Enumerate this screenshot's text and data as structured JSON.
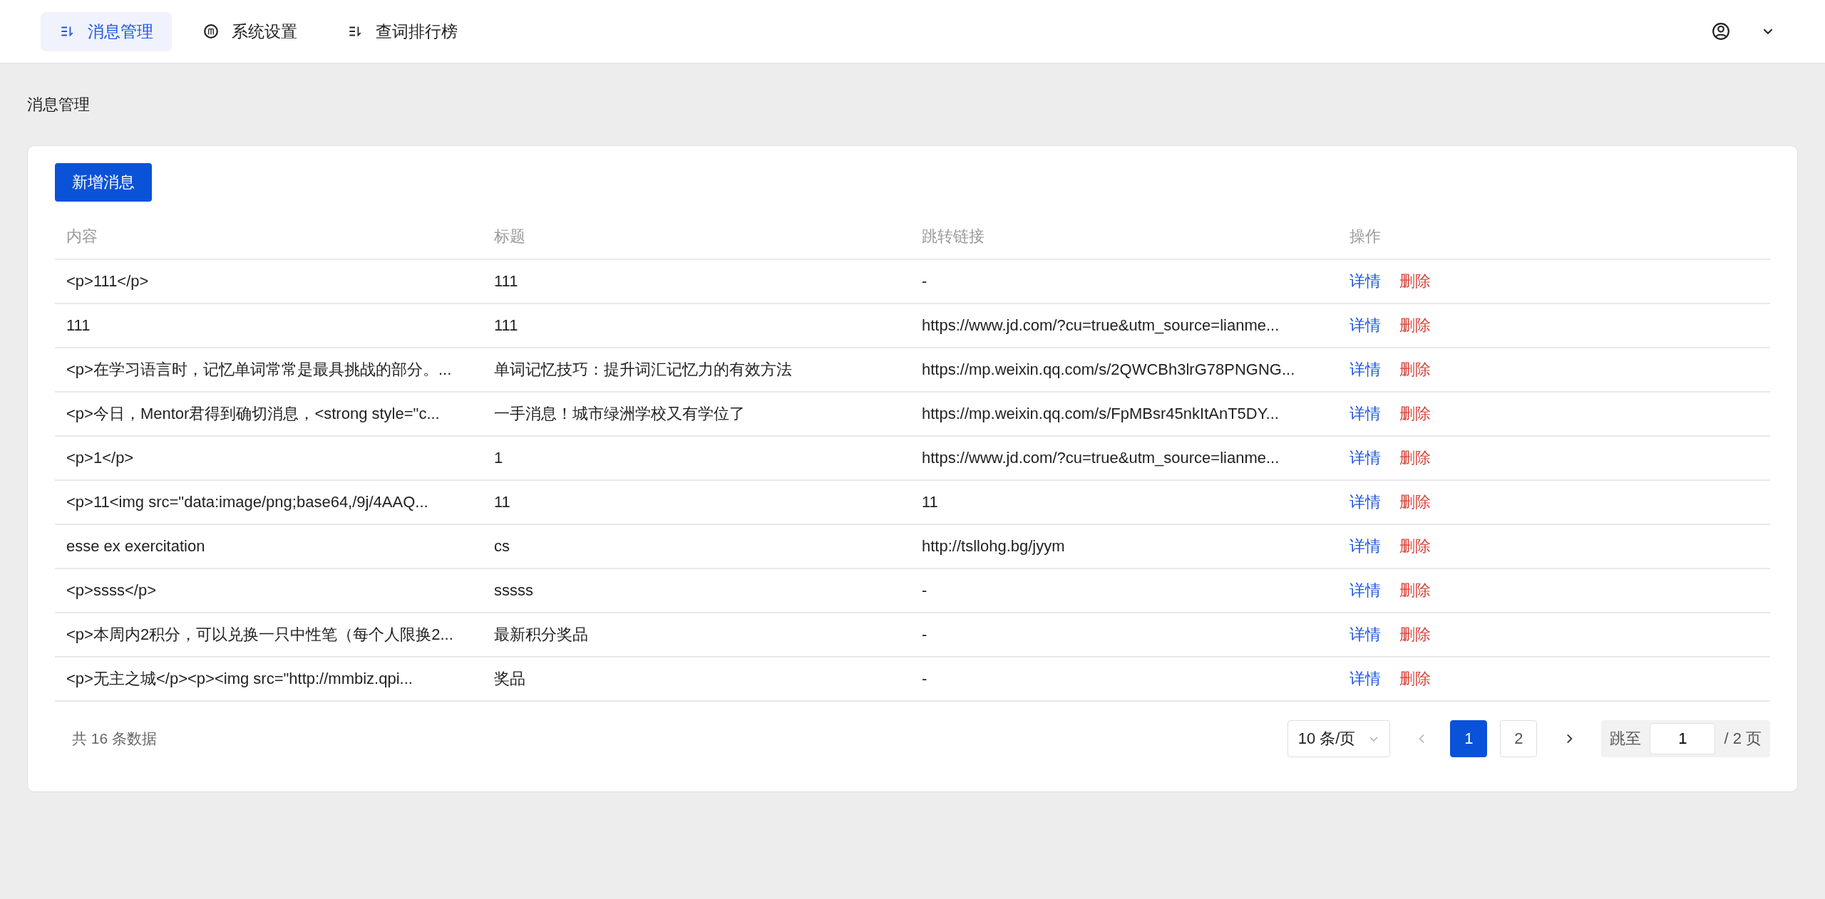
{
  "nav": {
    "items": [
      {
        "label": "消息管理",
        "kind": "list",
        "selected": true
      },
      {
        "label": "系统设置",
        "kind": "settings",
        "selected": false
      },
      {
        "label": "查词排行榜",
        "kind": "list",
        "selected": false
      }
    ]
  },
  "breadcrumb": "消息管理",
  "add_button": "新增消息",
  "table": {
    "columns": [
      "内容",
      "标题",
      "跳转链接",
      "操作"
    ],
    "rows": [
      {
        "content": "<p>111</p>",
        "title": "111",
        "link": "-",
        "actions": [
          "详情",
          "删除"
        ]
      },
      {
        "content": "111",
        "title": "111",
        "link": "https://www.jd.com/?cu=true&utm_source=lianme...",
        "actions": [
          "详情",
          "删除"
        ]
      },
      {
        "content": "<p>在学习语言时，记忆单词常常是最具挑战的部分。...",
        "title": "单词记忆技巧：提升词汇记忆力的有效方法",
        "link": "https://mp.weixin.qq.com/s/2QWCBh3lrG78PNGNG...",
        "actions": [
          "详情",
          "删除"
        ]
      },
      {
        "content": "<p>今日，Mentor君得到确切消息，<strong style=\"c...",
        "title": "一手消息！城市绿洲学校又有学位了",
        "link": "https://mp.weixin.qq.com/s/FpMBsr45nkItAnT5DY...",
        "actions": [
          "详情",
          "删除"
        ]
      },
      {
        "content": "<p>1</p>",
        "title": "1",
        "link": "https://www.jd.com/?cu=true&utm_source=lianme...",
        "actions": [
          "详情",
          "删除"
        ]
      },
      {
        "content": "<p>11<img src=\"data:image/png;base64,/9j/4AAQ...",
        "title": "11",
        "link": "11",
        "actions": [
          "详情",
          "删除"
        ]
      },
      {
        "content": "esse ex exercitation",
        "title": "cs",
        "link": "http://tsllohg.bg/jyym",
        "actions": [
          "详情",
          "删除"
        ]
      },
      {
        "content": "<p>ssss</p>",
        "title": "sssss",
        "link": "-",
        "actions": [
          "详情",
          "删除"
        ]
      },
      {
        "content": "<p>本周内2积分，可以兑换一只中性笔（每个人限换2...",
        "title": "最新积分奖品",
        "link": "-",
        "actions": [
          "详情",
          "删除"
        ]
      },
      {
        "content": "<p>无主之城</p><p><img src=\"http://mmbiz.qpi...",
        "title": "奖品",
        "link": "-",
        "actions": [
          "详情",
          "删除"
        ]
      }
    ]
  },
  "pagination": {
    "total": "共 16 条数据",
    "page_size": "10 条/页",
    "pages": [
      {
        "label": "1",
        "selected": true
      },
      {
        "label": "2",
        "selected": false
      }
    ],
    "jump_label": "跳至",
    "jump_value": "1",
    "jump_suffix": "/ 2 页"
  }
}
